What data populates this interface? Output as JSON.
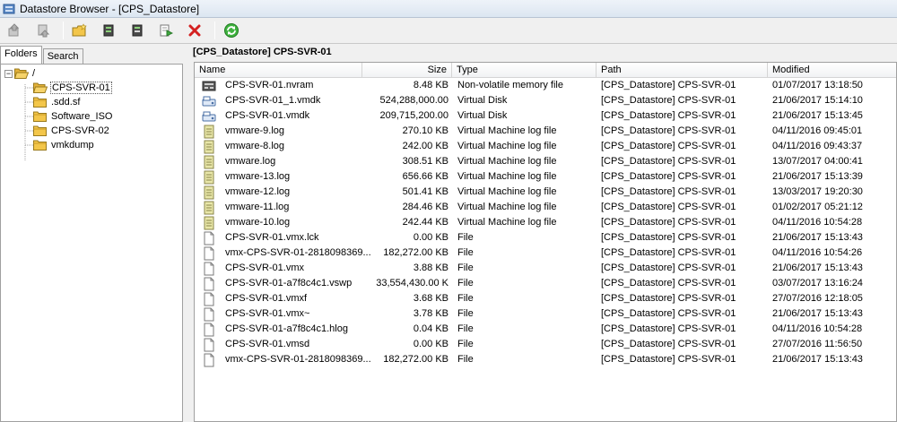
{
  "window": {
    "title": "Datastore Browser - [CPS_Datastore]"
  },
  "toolbar": {
    "buttons": [
      {
        "icon": "upload-icon",
        "label": ""
      },
      {
        "icon": "download-icon",
        "label": ""
      },
      {
        "icon": "new-folder-icon",
        "label": ""
      },
      {
        "icon": "upload-file-icon",
        "label": ""
      },
      {
        "icon": "download-file-icon",
        "label": ""
      },
      {
        "icon": "inventory-icon",
        "label": ""
      },
      {
        "icon": "delete-icon",
        "label": ""
      },
      {
        "icon": "refresh-icon",
        "label": ""
      }
    ]
  },
  "left": {
    "tabs": [
      {
        "label": "Folders",
        "active": true
      },
      {
        "label": "Search",
        "active": false
      }
    ],
    "root": {
      "expander": "−",
      "label": "/"
    },
    "folders": [
      "CPS-SVR-01",
      ".sdd.sf",
      "Software_ISO",
      "CPS-SVR-02",
      "vmkdump"
    ]
  },
  "right": {
    "path_header": "[CPS_Datastore] CPS-SVR-01",
    "columns": {
      "name": "Name",
      "size": "Size",
      "type": "Type",
      "path": "Path",
      "modified": "Modified"
    },
    "files": [
      {
        "icon": "nvram",
        "name": "CPS-SVR-01.nvram",
        "size": "8.48 KB",
        "type": "Non-volatile memory file",
        "path": "[CPS_Datastore] CPS-SVR-01",
        "modified": "01/07/2017 13:18:50"
      },
      {
        "icon": "disk",
        "name": "CPS-SVR-01_1.vmdk",
        "size": "524,288,000.00",
        "type": "Virtual Disk",
        "path": "[CPS_Datastore] CPS-SVR-01",
        "modified": "21/06/2017 15:14:10"
      },
      {
        "icon": "disk",
        "name": "CPS-SVR-01.vmdk",
        "size": "209,715,200.00",
        "type": "Virtual Disk",
        "path": "[CPS_Datastore] CPS-SVR-01",
        "modified": "21/06/2017 15:13:45"
      },
      {
        "icon": "log",
        "name": "vmware-9.log",
        "size": "270.10 KB",
        "type": "Virtual Machine log file",
        "path": "[CPS_Datastore] CPS-SVR-01",
        "modified": "04/11/2016 09:45:01"
      },
      {
        "icon": "log",
        "name": "vmware-8.log",
        "size": "242.00 KB",
        "type": "Virtual Machine log file",
        "path": "[CPS_Datastore] CPS-SVR-01",
        "modified": "04/11/2016 09:43:37"
      },
      {
        "icon": "log",
        "name": "vmware.log",
        "size": "308.51 KB",
        "type": "Virtual Machine log file",
        "path": "[CPS_Datastore] CPS-SVR-01",
        "modified": "13/07/2017 04:00:41"
      },
      {
        "icon": "log",
        "name": "vmware-13.log",
        "size": "656.66 KB",
        "type": "Virtual Machine log file",
        "path": "[CPS_Datastore] CPS-SVR-01",
        "modified": "21/06/2017 15:13:39"
      },
      {
        "icon": "log",
        "name": "vmware-12.log",
        "size": "501.41 KB",
        "type": "Virtual Machine log file",
        "path": "[CPS_Datastore] CPS-SVR-01",
        "modified": "13/03/2017 19:20:30"
      },
      {
        "icon": "log",
        "name": "vmware-11.log",
        "size": "284.46 KB",
        "type": "Virtual Machine log file",
        "path": "[CPS_Datastore] CPS-SVR-01",
        "modified": "01/02/2017 05:21:12"
      },
      {
        "icon": "log",
        "name": "vmware-10.log",
        "size": "242.44 KB",
        "type": "Virtual Machine log file",
        "path": "[CPS_Datastore] CPS-SVR-01",
        "modified": "04/11/2016 10:54:28"
      },
      {
        "icon": "file",
        "name": "CPS-SVR-01.vmx.lck",
        "size": "0.00 KB",
        "type": "File",
        "path": "[CPS_Datastore] CPS-SVR-01",
        "modified": "21/06/2017 15:13:43"
      },
      {
        "icon": "file",
        "name": "vmx-CPS-SVR-01-2818098369...",
        "size": "182,272.00 KB",
        "type": "File",
        "path": "[CPS_Datastore] CPS-SVR-01",
        "modified": "04/11/2016 10:54:26"
      },
      {
        "icon": "file",
        "name": "CPS-SVR-01.vmx",
        "size": "3.88 KB",
        "type": "File",
        "path": "[CPS_Datastore] CPS-SVR-01",
        "modified": "21/06/2017 15:13:43"
      },
      {
        "icon": "file",
        "name": "CPS-SVR-01-a7f8c4c1.vswp",
        "size": "33,554,430.00 K",
        "type": "File",
        "path": "[CPS_Datastore] CPS-SVR-01",
        "modified": "03/07/2017 13:16:24"
      },
      {
        "icon": "file",
        "name": "CPS-SVR-01.vmxf",
        "size": "3.68 KB",
        "type": "File",
        "path": "[CPS_Datastore] CPS-SVR-01",
        "modified": "27/07/2016 12:18:05"
      },
      {
        "icon": "file",
        "name": "CPS-SVR-01.vmx~",
        "size": "3.78 KB",
        "type": "File",
        "path": "[CPS_Datastore] CPS-SVR-01",
        "modified": "21/06/2017 15:13:43"
      },
      {
        "icon": "file",
        "name": "CPS-SVR-01-a7f8c4c1.hlog",
        "size": "0.04 KB",
        "type": "File",
        "path": "[CPS_Datastore] CPS-SVR-01",
        "modified": "04/11/2016 10:54:28"
      },
      {
        "icon": "file",
        "name": "CPS-SVR-01.vmsd",
        "size": "0.00 KB",
        "type": "File",
        "path": "[CPS_Datastore] CPS-SVR-01",
        "modified": "27/07/2016 11:56:50"
      },
      {
        "icon": "file",
        "name": "vmx-CPS-SVR-01-2818098369...",
        "size": "182,272.00 KB",
        "type": "File",
        "path": "[CPS_Datastore] CPS-SVR-01",
        "modified": "21/06/2017 15:13:43"
      }
    ]
  },
  "colors": {
    "folder_fill": "#f3c64a",
    "delete_red": "#d42020",
    "refresh_green": "#2ea02e"
  }
}
